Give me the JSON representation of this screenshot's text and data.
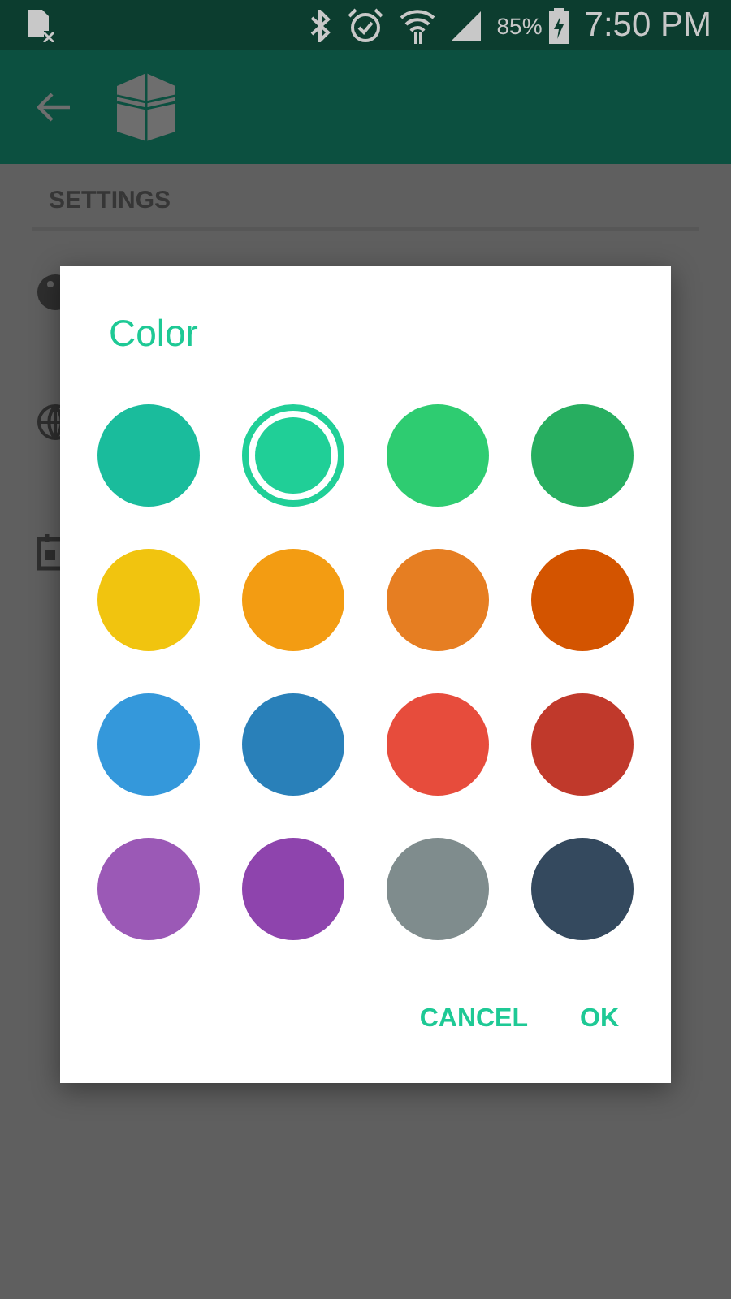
{
  "status_bar": {
    "battery_percent": "85%",
    "time": "7:50 PM"
  },
  "settings": {
    "section_header": "SETTINGS"
  },
  "dialog": {
    "title": "Color",
    "colors": [
      {
        "color": "#1abc9c",
        "selected": false
      },
      {
        "color": "#20cf97",
        "selected": true
      },
      {
        "color": "#2ecc71",
        "selected": false
      },
      {
        "color": "#27ae60",
        "selected": false
      },
      {
        "color": "#f1c40f",
        "selected": false
      },
      {
        "color": "#f39c12",
        "selected": false
      },
      {
        "color": "#e67e22",
        "selected": false
      },
      {
        "color": "#d35400",
        "selected": false
      },
      {
        "color": "#3498db",
        "selected": false
      },
      {
        "color": "#2980b9",
        "selected": false
      },
      {
        "color": "#e74c3c",
        "selected": false
      },
      {
        "color": "#c0392b",
        "selected": false
      },
      {
        "color": "#9b59b6",
        "selected": false
      },
      {
        "color": "#8e44ad",
        "selected": false
      },
      {
        "color": "#7f8c8d",
        "selected": false
      },
      {
        "color": "#34495e",
        "selected": false
      }
    ],
    "buttons": [
      "CANCEL",
      "OK"
    ]
  }
}
